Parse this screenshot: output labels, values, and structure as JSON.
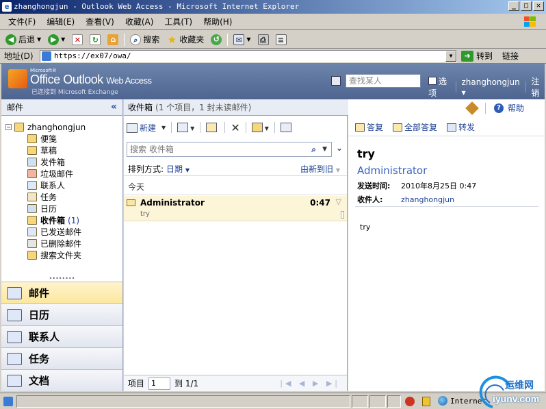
{
  "window": {
    "title": "zhanghongjun - Outlook Web Access - Microsoft Internet Explorer",
    "buttons": [
      "_",
      "□",
      "✕"
    ]
  },
  "menu": [
    "文件(F)",
    "编辑(E)",
    "查看(V)",
    "收藏(A)",
    "工具(T)",
    "帮助(H)"
  ],
  "toolbar": {
    "back": "后退",
    "search": "搜索",
    "favorites": "收藏夹"
  },
  "address": {
    "label": "地址(D)",
    "url": "https://ex07/owa/",
    "go": "转到",
    "links": "链接"
  },
  "owa": {
    "ms": "Microsoft®",
    "product": "Office Outlook",
    "product_suffix": "Web Access",
    "connected": "已连接到 Microsoft Exchange",
    "find_placeholder": "查找某人",
    "options": "选项",
    "user": "zhanghongjun",
    "logoff": "注销"
  },
  "nav": {
    "header": "邮件",
    "root": "zhanghongjun",
    "folders": [
      {
        "label": "便笺",
        "color": "#f6d77c"
      },
      {
        "label": "草稿",
        "color": "#f6d77c"
      },
      {
        "label": "发件箱",
        "color": "#cfdff5"
      },
      {
        "label": "垃圾邮件",
        "color": "#f4b4a4"
      },
      {
        "label": "联系人",
        "color": "#dfe8f8"
      },
      {
        "label": "任务",
        "color": "#f1e6c6"
      },
      {
        "label": "日历",
        "color": "#cfdff5"
      },
      {
        "label": "收件箱",
        "count": "(1)",
        "selected": true,
        "color": "#f6d77c"
      },
      {
        "label": "已发送邮件",
        "color": "#dfe8f8"
      },
      {
        "label": "已删除邮件",
        "color": "#e5e5e5"
      },
      {
        "label": "搜索文件夹",
        "color": "#f6d77c"
      }
    ],
    "modules": [
      {
        "label": "邮件",
        "active": true
      },
      {
        "label": "日历"
      },
      {
        "label": "联系人"
      },
      {
        "label": "任务"
      },
      {
        "label": "文档"
      }
    ]
  },
  "list": {
    "folder": "收件箱",
    "summary": "(1 个项目，1 封未读邮件)",
    "new": "新建",
    "search_placeholder": "搜索 收件箱",
    "sort_label": "排列方式:",
    "sort_by": "日期",
    "sort_order": "由新到旧",
    "group": "今天",
    "messages": [
      {
        "from": "Administrator",
        "time": "0:47",
        "preview": "try"
      }
    ],
    "pager_label": "项目",
    "pager_value": "1",
    "pager_total": "到 1/1"
  },
  "reading": {
    "help": "帮助",
    "reply": "答复",
    "reply_all": "全部答复",
    "forward": "转发",
    "subject": "try",
    "from": "Administrator",
    "sent_label": "发送时间:",
    "sent_value": "2010年8月25日 0:47",
    "to_label": "收件人:",
    "to_value": "zhanghongjun",
    "body": "try"
  },
  "status": {
    "zone": "Internet"
  },
  "watermark": {
    "text": "运维网",
    "url": "iyunv.com"
  }
}
